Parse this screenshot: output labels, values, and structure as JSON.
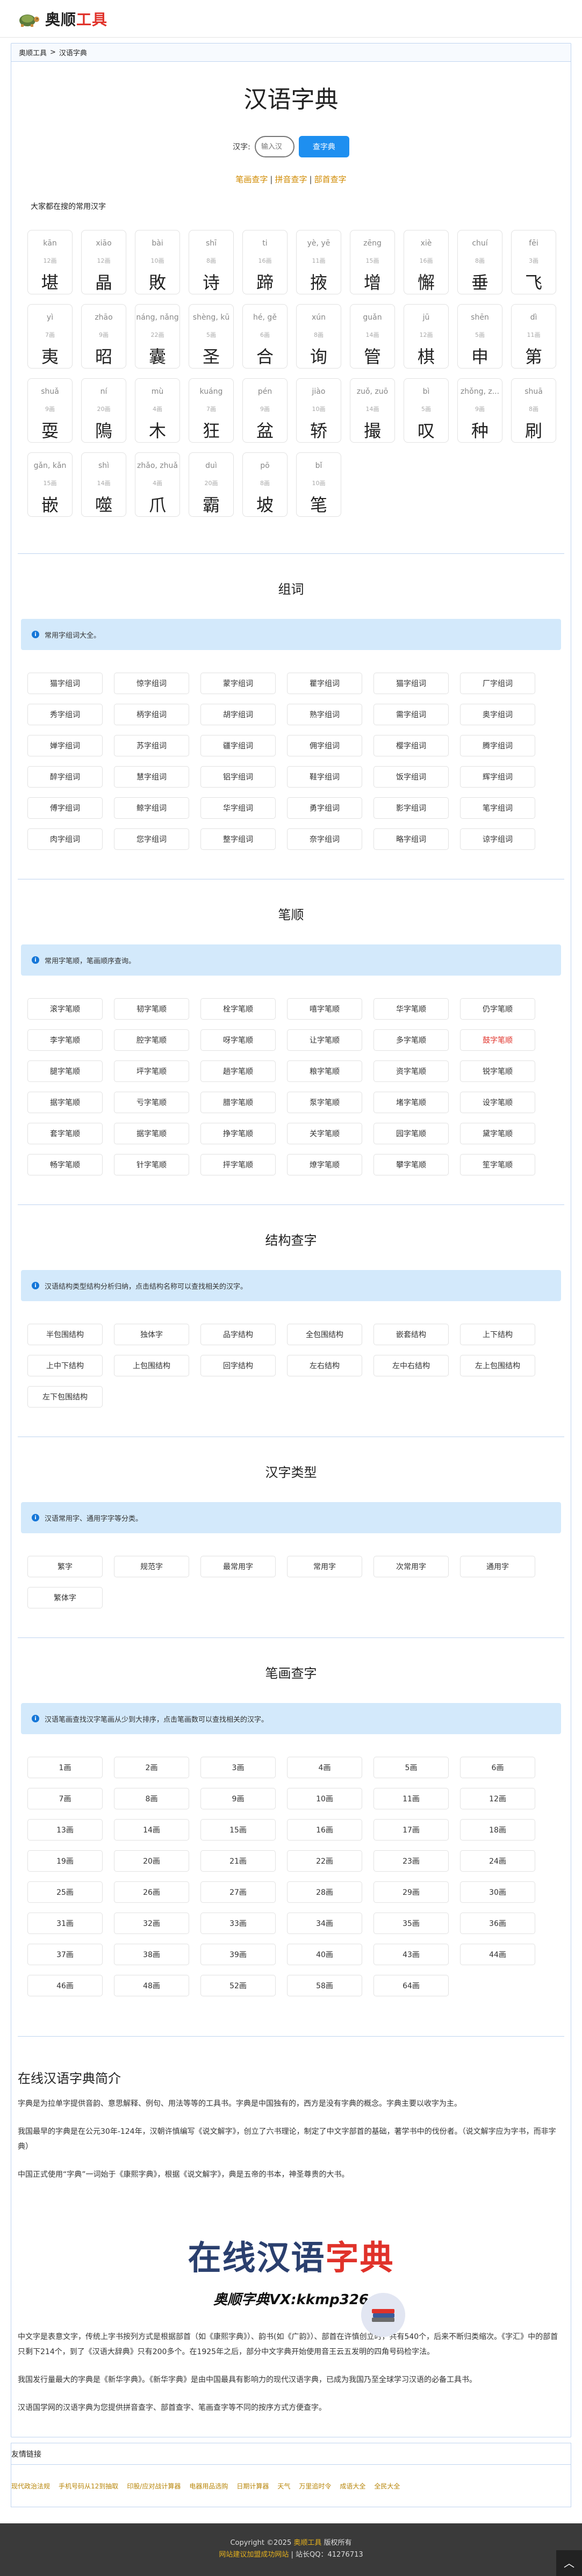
{
  "header": {
    "logo_a": "奥顺",
    "logo_b": "工具"
  },
  "breadcrumb": {
    "home": "奥顺工具",
    "sep": ">",
    "current": "汉语字典"
  },
  "page_title": "汉语字典",
  "search": {
    "label": "汉字:",
    "placeholder": "输入汉",
    "button": "查字典"
  },
  "quick_links": [
    "笔画查字",
    "拼音查字",
    "部首查字"
  ],
  "common_label": "大家都在搜的常用汉字",
  "chars": [
    {
      "py": "kān",
      "st": "12画",
      "ch": "堪"
    },
    {
      "py": "xiāo",
      "st": "12画",
      "ch": "晶"
    },
    {
      "py": "bài",
      "st": "10画",
      "ch": "敗"
    },
    {
      "py": "shī",
      "st": "8画",
      "ch": "诗"
    },
    {
      "py": "ti",
      "st": "16画",
      "ch": "蹄"
    },
    {
      "py": "yè, yē",
      "st": "11画",
      "ch": "掖"
    },
    {
      "py": "zēng",
      "st": "15画",
      "ch": "增"
    },
    {
      "py": "xiè",
      "st": "16画",
      "ch": "懈"
    },
    {
      "py": "chuí",
      "st": "8画",
      "ch": "垂"
    },
    {
      "py": "fēi",
      "st": "3画",
      "ch": "飞"
    },
    {
      "py": "yì",
      "st": "7画",
      "ch": "夷"
    },
    {
      "py": "zhāo",
      "st": "9画",
      "ch": "昭"
    },
    {
      "py": "náng, nǎng",
      "st": "22画",
      "ch": "囊"
    },
    {
      "py": "shèng, kū",
      "st": "5画",
      "ch": "圣"
    },
    {
      "py": "hé, gě",
      "st": "6画",
      "ch": "合"
    },
    {
      "py": "xún",
      "st": "8画",
      "ch": "询"
    },
    {
      "py": "guǎn",
      "st": "14画",
      "ch": "管"
    },
    {
      "py": "jū",
      "st": "12画",
      "ch": "棋"
    },
    {
      "py": "shēn",
      "st": "5画",
      "ch": "申"
    },
    {
      "py": "dì",
      "st": "11画",
      "ch": "第"
    },
    {
      "py": "shuǎ",
      "st": "9画",
      "ch": "耍"
    },
    {
      "py": "ní",
      "st": "20画",
      "ch": "隝"
    },
    {
      "py": "mù",
      "st": "4画",
      "ch": "木"
    },
    {
      "py": "kuáng",
      "st": "7画",
      "ch": "狂"
    },
    {
      "py": "pén",
      "st": "9画",
      "ch": "盆"
    },
    {
      "py": "jiào",
      "st": "10画",
      "ch": "轿"
    },
    {
      "py": "zuǒ, zuō",
      "st": "14画",
      "ch": "撮"
    },
    {
      "py": "bì",
      "st": "5画",
      "ch": "叹"
    },
    {
      "py": "zhǒng, z...",
      "st": "9画",
      "ch": "种"
    },
    {
      "py": "shuā",
      "st": "8画",
      "ch": "刷"
    },
    {
      "py": "gǎn, kǎn",
      "st": "15画",
      "ch": "嵌"
    },
    {
      "py": "shì",
      "st": "14画",
      "ch": "噬"
    },
    {
      "py": "zhǎo, zhuǎ",
      "st": "4画",
      "ch": "爪"
    },
    {
      "py": "duì",
      "st": "20画",
      "ch": "霸"
    },
    {
      "py": "pō",
      "st": "8画",
      "ch": "坡"
    },
    {
      "py": "bǐ",
      "st": "10画",
      "ch": "笔"
    }
  ],
  "zuci": {
    "title": "组词",
    "notice": "常用字组词大全。",
    "items": [
      "猫字组词",
      "惊字组词",
      "蒙字组词",
      "瞿字组词",
      "猫字组词",
      "厂字组词",
      "秀字组词",
      "柄字组词",
      "胡字组词",
      "熟字组词",
      "需字组词",
      "奥字组词",
      "婵字组词",
      "苏字组词",
      "疆字组词",
      "佣字组词",
      "樱字组词",
      "腾字组词",
      "醉字组词",
      "慧字组词",
      "铝字组词",
      "鞋字组词",
      "饭字组词",
      "辉字组词",
      "傅字组词",
      "鲸字组词",
      "华字组词",
      "勇字组词",
      "影字组词",
      "笔字组词",
      "肉字组词",
      "您字组词",
      "整字组词",
      "奈字组词",
      "略字组词",
      "谅字组词"
    ]
  },
  "bishun": {
    "title": "笔顺",
    "notice": "常用字笔顺，笔画顺序查询。",
    "items": [
      "滚字笔顺",
      "韧字笔顺",
      "栓字笔顺",
      "嘻字笔顺",
      "华字笔顺",
      "仍字笔顺",
      "李字笔顺",
      "腔字笔顺",
      "呀字笔顺",
      "让字笔顺",
      "多字笔顺",
      "鼓字笔顺",
      "腿字笔顺",
      "坪字笔顺",
      "趟字笔顺",
      "粮字笔顺",
      "资字笔顺",
      "锐字笔顺",
      "据字笔顺",
      "亏字笔顺",
      "腊字笔顺",
      "泵字笔顺",
      "堵字笔顺",
      "设字笔顺",
      "套字笔顺",
      "据字笔顺",
      "挣字笔顺",
      "关字笔顺",
      "园字笔顺",
      "黛字笔顺",
      "畅字笔顺",
      "针字笔顺",
      "抨字笔顺",
      "燎字笔顺",
      "攀字笔顺",
      "笙字笔顺"
    ],
    "highlight_index": 11
  },
  "jiegou": {
    "title": "结构查字",
    "notice": "汉语结构类型结构分析归纳，点击结构名称可以查找相关的汉字。",
    "items": [
      "半包围结构",
      "独体字",
      "品字结构",
      "全包围结构",
      "嵌套结构",
      "上下结构",
      "上中下结构",
      "上包围结构",
      "回字结构",
      "左右结构",
      "左中右结构",
      "左上包围结构",
      "左下包围结构"
    ]
  },
  "leixing": {
    "title": "汉字类型",
    "notice": "汉语常用字、通用字字等分类。",
    "items": [
      "繁字",
      "规范字",
      "最常用字",
      "常用字",
      "次常用字",
      "通用字",
      "繁体字"
    ]
  },
  "bihua": {
    "title": "笔画查字",
    "notice": "汉语笔画查找汉字笔画从少到大排序，点击笔画数可以查找相关的汉字。",
    "items": [
      "1画",
      "2画",
      "3画",
      "4画",
      "5画",
      "6画",
      "7画",
      "8画",
      "9画",
      "10画",
      "11画",
      "12画",
      "13画",
      "14画",
      "15画",
      "16画",
      "17画",
      "18画",
      "19画",
      "20画",
      "21画",
      "22画",
      "23画",
      "24画",
      "25画",
      "26画",
      "27画",
      "28画",
      "29画",
      "30画",
      "31画",
      "32画",
      "33画",
      "34画",
      "35画",
      "36画",
      "37画",
      "38画",
      "39画",
      "40画",
      "43画",
      "44画",
      "46画",
      "48画",
      "52画",
      "58画",
      "64画"
    ]
  },
  "intro": {
    "title": "在线汉语字典简介",
    "p1": "字典是为拉单字提供音韵、意思解释、例句、用法等等的工具书。字典是中国独有的，西方是没有字典的概念。字典主要以收字为主。",
    "p2": "我国最早的字典是在公元30年-124年，汉朝许慎编写《说文解字》，创立了六书理论，制定了中文字部首的基础，著学书中的伐份者。（说文解字应为字书，而非字典）",
    "p3": "中国正式使用“字典”一词始于《康熙字典》，根据《说文解字》，典是五帝的书本，神圣尊贵的大书。",
    "banner_a": "在线汉语",
    "banner_b": "字典",
    "banner_sub": "奥顺字典VX:kkmp326",
    "p4": "中文字是表意文字，传统上字书按列方式是根据部首（如《康熙字典》）、韵书(如《广韵》）、部首在许慎创立时，共有540个，后来不断归类缩次。《字汇》中的部首只剩下214个，到了《汉语大辞典》只有200多个。在1925年之后，部分中文字典开始使用音王云五发明的四角号码检字法。",
    "p5": "我国发行量最大的字典是《新华字典》。《新华字典》是由中国最具有影响力的现代汉语字典，已成为我国乃至全球学习汉语的必备工具书。",
    "p6": "汉语国学网的汉语字典为您提供拼音查字、部首查字、笔画查字等不同的按序方式方便查字。"
  },
  "links": {
    "title": "友情链接",
    "items": [
      "现代政治法规",
      "手机号码从12到抽取",
      "印股/应对战计算器",
      "电器用品选购",
      "日期计算器",
      "天气",
      "万里追时令",
      "成语大全",
      "全民大全"
    ]
  },
  "footer": {
    "line1_a": "Copyright ©2025 ",
    "line1_b": "奥顺工具",
    "line1_c": " 版权所有",
    "line2_a": "网站建议加盟成功网站",
    "line2_b": " | 站长QQ：41276713"
  },
  "colors": {
    "accent": "#1e8ff0",
    "brand_red": "#e0322a",
    "link_gold": "#d08a00",
    "notice_bg": "#d3e9fb"
  }
}
